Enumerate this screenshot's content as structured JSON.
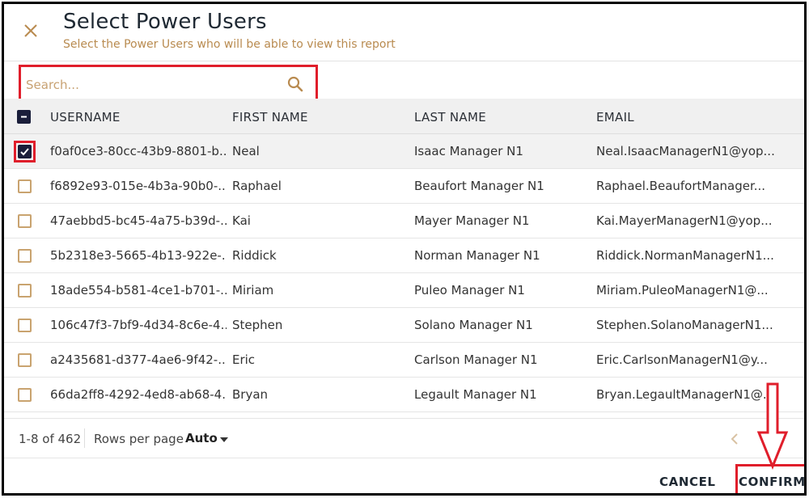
{
  "dialog": {
    "title": "Select Power Users",
    "subtitle": "Select the Power Users who will be able to view this report"
  },
  "search": {
    "placeholder": "Search...",
    "value": ""
  },
  "table": {
    "columns": [
      "USERNAME",
      "FIRST NAME",
      "LAST NAME",
      "EMAIL"
    ],
    "header_checkbox_state": "indeterminate",
    "rows": [
      {
        "username": "f0af0ce3-80cc-43b9-8801-b...",
        "first_name": "Neal",
        "last_name": "Isaac Manager N1",
        "email": "Neal.IsaacManagerN1@yop...",
        "checked": true
      },
      {
        "username": "f6892e93-015e-4b3a-90b0-...",
        "first_name": "Raphael",
        "last_name": "Beaufort Manager N1",
        "email": "Raphael.BeaufortManager...",
        "checked": false
      },
      {
        "username": "47aebbd5-bc45-4a75-b39d-...",
        "first_name": "Kai",
        "last_name": "Mayer Manager N1",
        "email": "Kai.MayerManagerN1@yop...",
        "checked": false
      },
      {
        "username": "5b2318e3-5665-4b13-922e-...",
        "first_name": "Riddick",
        "last_name": "Norman Manager N1",
        "email": "Riddick.NormanManagerN1...",
        "checked": false
      },
      {
        "username": "18ade554-b581-4ce1-b701-...",
        "first_name": "Miriam",
        "last_name": "Puleo Manager N1",
        "email": "Miriam.PuleoManagerN1@...",
        "checked": false
      },
      {
        "username": "106c47f3-7bf9-4d34-8c6e-4...",
        "first_name": "Stephen",
        "last_name": "Solano Manager N1",
        "email": "Stephen.SolanoManagerN1...",
        "checked": false
      },
      {
        "username": "a2435681-d377-4ae6-9f42-...",
        "first_name": "Eric",
        "last_name": "Carlson Manager N1",
        "email": "Eric.CarlsonManagerN1@y...",
        "checked": false
      },
      {
        "username": "66da2ff8-4292-4ed8-ab68-4...",
        "first_name": "Bryan",
        "last_name": "Legault Manager N1",
        "email": "Bryan.LegaultManagerN1@...",
        "checked": false
      }
    ]
  },
  "pagination": {
    "range": "1-8 of 462",
    "rows_per_page_label": "Rows per page",
    "rows_per_page_value": "Auto"
  },
  "actions": {
    "cancel": "CANCEL",
    "confirm": "CONFIRM"
  },
  "colors": {
    "accent": "#b98b50",
    "highlight": "#e01e2b",
    "checkbox_checked": "#1a1e3a"
  },
  "icons": {
    "close": "close-icon",
    "search": "search-icon",
    "caret": "caret-down-icon",
    "prev": "chevron-left-icon",
    "next": "chevron-right-icon"
  }
}
